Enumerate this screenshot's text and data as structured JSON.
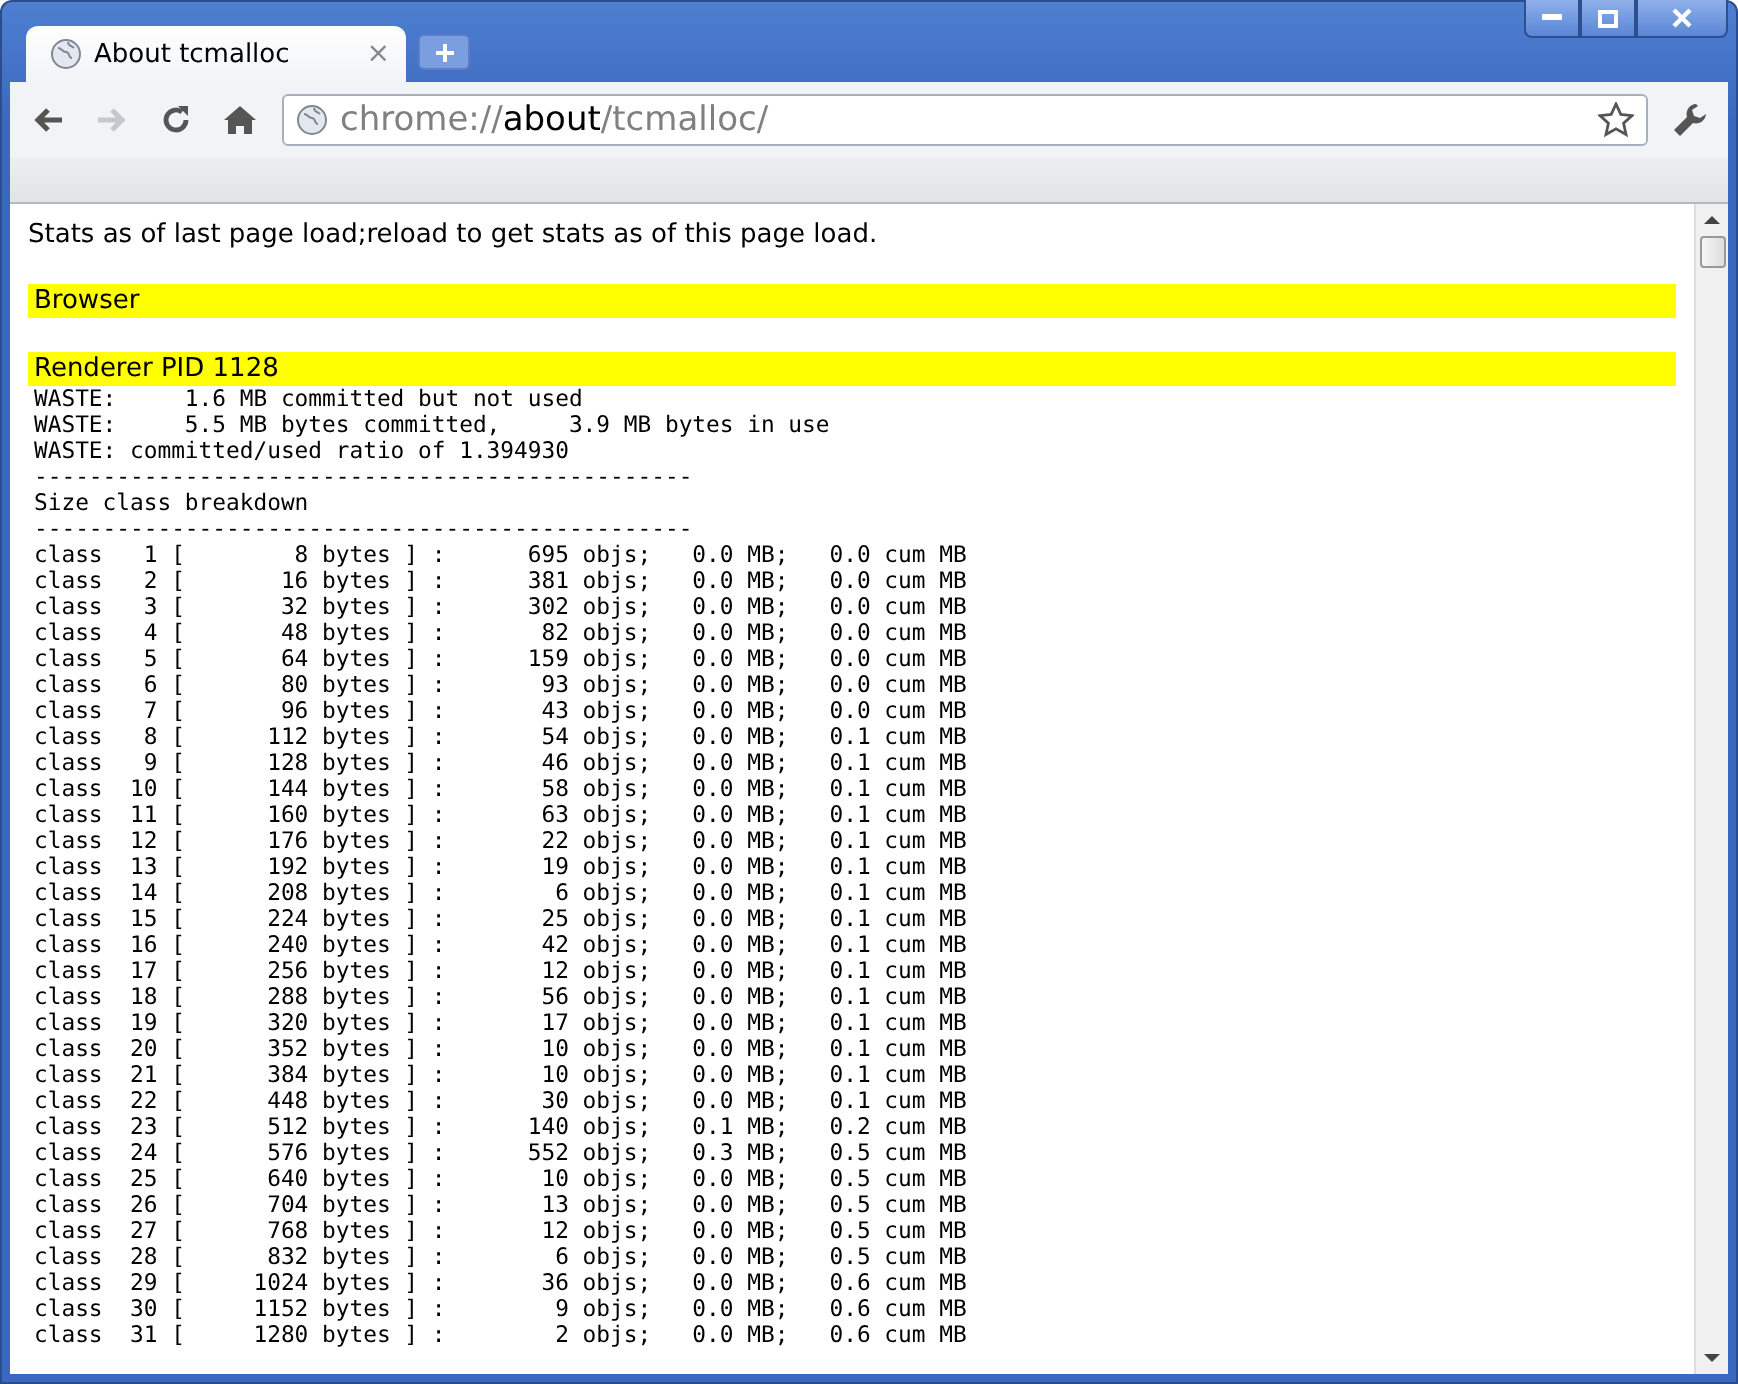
{
  "tab": {
    "title": "About tcmalloc",
    "close": "×",
    "selected": true
  },
  "address": {
    "scheme": "chrome://",
    "host": "about",
    "path": "/tcmalloc/"
  },
  "page": {
    "intro": "Stats as of last page load;reload to get stats as of this page load.",
    "sections": [
      {
        "heading": "Browser"
      },
      {
        "heading": "Renderer PID 1128",
        "lines": [
          "WASTE:     1.6 MB committed but not used",
          "WASTE:     5.5 MB bytes committed,     3.9 MB bytes in use",
          "WASTE: committed/used ratio of 1.394930",
          "------------------------------------------------",
          "Size class breakdown",
          "------------------------------------------------",
          "class   1 [        8 bytes ] :      695 objs;   0.0 MB;   0.0 cum MB",
          "class   2 [       16 bytes ] :      381 objs;   0.0 MB;   0.0 cum MB",
          "class   3 [       32 bytes ] :      302 objs;   0.0 MB;   0.0 cum MB",
          "class   4 [       48 bytes ] :       82 objs;   0.0 MB;   0.0 cum MB",
          "class   5 [       64 bytes ] :      159 objs;   0.0 MB;   0.0 cum MB",
          "class   6 [       80 bytes ] :       93 objs;   0.0 MB;   0.0 cum MB",
          "class   7 [       96 bytes ] :       43 objs;   0.0 MB;   0.0 cum MB",
          "class   8 [      112 bytes ] :       54 objs;   0.0 MB;   0.1 cum MB",
          "class   9 [      128 bytes ] :       46 objs;   0.0 MB;   0.1 cum MB",
          "class  10 [      144 bytes ] :       58 objs;   0.0 MB;   0.1 cum MB",
          "class  11 [      160 bytes ] :       63 objs;   0.0 MB;   0.1 cum MB",
          "class  12 [      176 bytes ] :       22 objs;   0.0 MB;   0.1 cum MB",
          "class  13 [      192 bytes ] :       19 objs;   0.0 MB;   0.1 cum MB",
          "class  14 [      208 bytes ] :        6 objs;   0.0 MB;   0.1 cum MB",
          "class  15 [      224 bytes ] :       25 objs;   0.0 MB;   0.1 cum MB",
          "class  16 [      240 bytes ] :       42 objs;   0.0 MB;   0.1 cum MB",
          "class  17 [      256 bytes ] :       12 objs;   0.0 MB;   0.1 cum MB",
          "class  18 [      288 bytes ] :       56 objs;   0.0 MB;   0.1 cum MB",
          "class  19 [      320 bytes ] :       17 objs;   0.0 MB;   0.1 cum MB",
          "class  20 [      352 bytes ] :       10 objs;   0.0 MB;   0.1 cum MB",
          "class  21 [      384 bytes ] :       10 objs;   0.0 MB;   0.1 cum MB",
          "class  22 [      448 bytes ] :       30 objs;   0.0 MB;   0.1 cum MB",
          "class  23 [      512 bytes ] :      140 objs;   0.1 MB;   0.2 cum MB",
          "class  24 [      576 bytes ] :      552 objs;   0.3 MB;   0.5 cum MB",
          "class  25 [      640 bytes ] :       10 objs;   0.0 MB;   0.5 cum MB",
          "class  26 [      704 bytes ] :       13 objs;   0.0 MB;   0.5 cum MB",
          "class  27 [      768 bytes ] :       12 objs;   0.0 MB;   0.5 cum MB",
          "class  28 [      832 bytes ] :        6 objs;   0.0 MB;   0.5 cum MB",
          "class  29 [     1024 bytes ] :       36 objs;   0.0 MB;   0.6 cum MB",
          "class  30 [     1152 bytes ] :        9 objs;   0.0 MB;   0.6 cum MB",
          "class  31 [     1280 bytes ] :        2 objs;   0.0 MB;   0.6 cum MB"
        ]
      }
    ]
  }
}
